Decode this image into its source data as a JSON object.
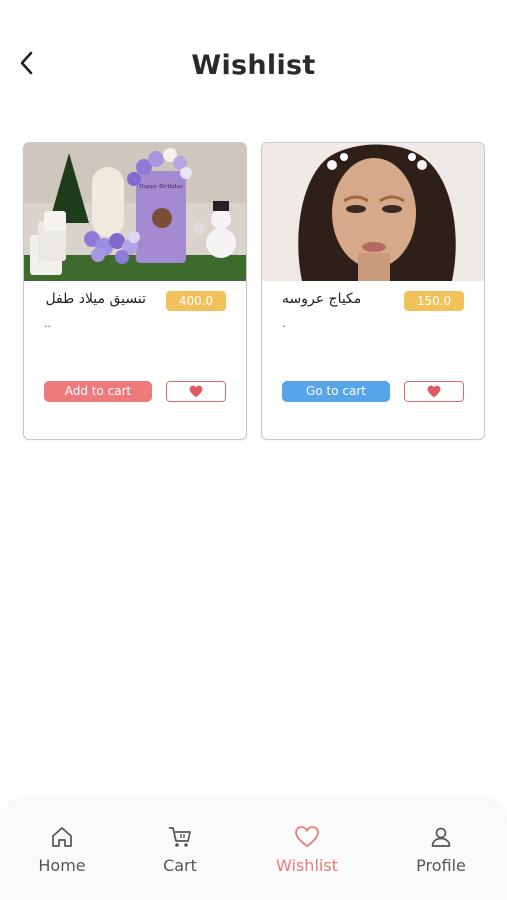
{
  "header": {
    "title": "Wishlist"
  },
  "items": [
    {
      "name": "تنسيق ميلاد طفل",
      "price": "400.0",
      "description": "..",
      "cart_button": "Add to cart",
      "image": "birthday-balloon-decoration-photo",
      "image_caption": "Happy Birthday"
    },
    {
      "name": "مكياج عروسه",
      "price": "150.0",
      "description": ".",
      "cart_button": "Go to cart",
      "image": "bridal-makeup-portrait-photo"
    }
  ],
  "nav": {
    "home": "Home",
    "cart": "Cart",
    "wishlist": "Wishlist",
    "profile": "Profile",
    "active": "wishlist"
  },
  "colors": {
    "price_badge": "#f3c15a",
    "add_to_cart": "#ee7b7b",
    "go_to_cart": "#58a4e8",
    "accent": "#ee7b7b"
  }
}
